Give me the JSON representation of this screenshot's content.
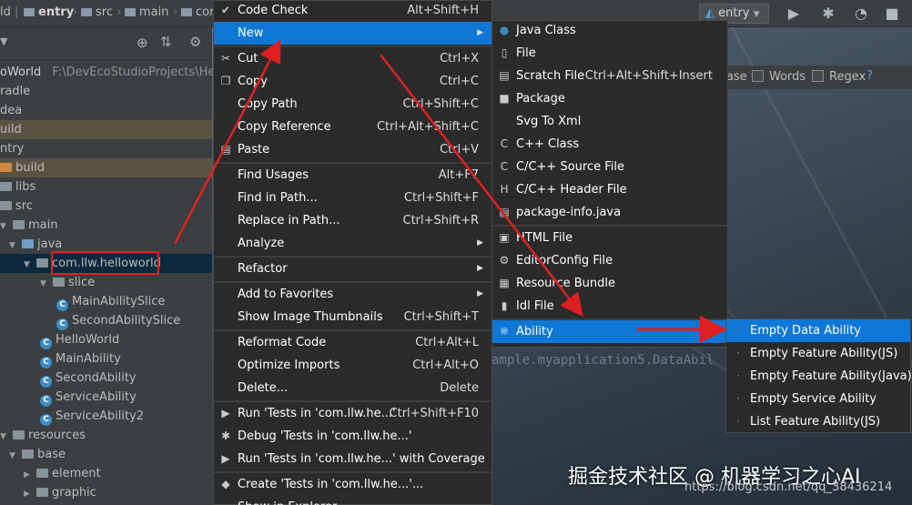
{
  "toolbar": {
    "crumbs": [
      "ld",
      "entry",
      "src",
      "main",
      "cor"
    ],
    "run_config": "entry"
  },
  "project_root": {
    "name": "oWorld",
    "path": "F:\\DevEcoStudioProjects\\HelloW"
  },
  "tree": [
    {
      "label": "radle",
      "indent": 0,
      "icon": "none",
      "style": "plain"
    },
    {
      "label": "dea",
      "indent": 0,
      "icon": "none",
      "style": "plain"
    },
    {
      "label": "uild",
      "indent": 0,
      "icon": "none",
      "style": "hl"
    },
    {
      "label": "ntry",
      "indent": 0,
      "icon": "none",
      "style": "plain"
    },
    {
      "label": "build",
      "indent": 0,
      "icon": "folder-orange",
      "style": "hl"
    },
    {
      "label": "libs",
      "indent": 0,
      "icon": "folder",
      "style": "plain"
    },
    {
      "label": "src",
      "indent": 0,
      "icon": "folder",
      "style": "plain"
    },
    {
      "label": "main",
      "indent": 1,
      "icon": "folder",
      "style": "plain"
    },
    {
      "label": "java",
      "indent": 2,
      "icon": "folder-blue",
      "style": "plain"
    },
    {
      "label": "com.llw.helloworld",
      "indent": 3,
      "icon": "folder",
      "style": "sel"
    },
    {
      "label": "slice",
      "indent": 4,
      "icon": "folder",
      "style": "plain"
    },
    {
      "label": "MainAbilitySlice",
      "indent": 5,
      "icon": "class",
      "style": "plain"
    },
    {
      "label": "SecondAbilitySlice",
      "indent": 5,
      "icon": "class",
      "style": "plain"
    },
    {
      "label": "HelloWorld",
      "indent": 4,
      "icon": "class",
      "style": "plain"
    },
    {
      "label": "MainAbility",
      "indent": 4,
      "icon": "class",
      "style": "plain"
    },
    {
      "label": "SecondAbility",
      "indent": 4,
      "icon": "class",
      "style": "plain"
    },
    {
      "label": "ServiceAbility",
      "indent": 4,
      "icon": "class",
      "style": "plain"
    },
    {
      "label": "ServiceAbility2",
      "indent": 4,
      "icon": "class",
      "style": "plain"
    },
    {
      "label": "resources",
      "indent": 1,
      "icon": "folder",
      "style": "plain"
    },
    {
      "label": "base",
      "indent": 2,
      "icon": "folder",
      "style": "plain"
    },
    {
      "label": "element",
      "indent": 3,
      "icon": "folder",
      "style": "plain"
    },
    {
      "label": "graphic",
      "indent": 3,
      "icon": "folder",
      "style": "plain"
    }
  ],
  "findbar": {
    "case_label": "ase",
    "words_label": "Words",
    "regex_label": "Regex",
    "help": "?"
  },
  "code_ghost": "ample.myapplication5.DataAbil",
  "context_menu": [
    {
      "label": "Code Check",
      "shortcut": "Alt+Shift+H",
      "icon": "check-icon"
    },
    {
      "label": "New",
      "shortcut": "",
      "submenu": true,
      "active": true
    },
    {
      "sep": true
    },
    {
      "label": "Cut",
      "shortcut": "Ctrl+X",
      "icon": "scissors-icon"
    },
    {
      "label": "Copy",
      "shortcut": "Ctrl+C",
      "icon": "copy-icon"
    },
    {
      "label": "Copy Path",
      "shortcut": "Ctrl+Shift+C"
    },
    {
      "label": "Copy Reference",
      "shortcut": "Ctrl+Alt+Shift+C"
    },
    {
      "label": "Paste",
      "shortcut": "Ctrl+V",
      "icon": "paste-icon"
    },
    {
      "sep": true
    },
    {
      "label": "Find Usages",
      "shortcut": "Alt+F7"
    },
    {
      "label": "Find in Path...",
      "shortcut": "Ctrl+Shift+F"
    },
    {
      "label": "Replace in Path...",
      "shortcut": "Ctrl+Shift+R"
    },
    {
      "label": "Analyze",
      "shortcut": "",
      "submenu": true
    },
    {
      "sep": true
    },
    {
      "label": "Refactor",
      "shortcut": "",
      "submenu": true
    },
    {
      "sep": true
    },
    {
      "label": "Add to Favorites",
      "shortcut": "",
      "submenu": true
    },
    {
      "label": "Show Image Thumbnails",
      "shortcut": "Ctrl+Shift+T"
    },
    {
      "sep": true
    },
    {
      "label": "Reformat Code",
      "shortcut": "Ctrl+Alt+L"
    },
    {
      "label": "Optimize Imports",
      "shortcut": "Ctrl+Alt+O"
    },
    {
      "label": "Delete...",
      "shortcut": "Delete"
    },
    {
      "sep": true
    },
    {
      "label": "Run 'Tests in 'com.llw.he...'",
      "shortcut": "Ctrl+Shift+F10",
      "icon": "run-icon"
    },
    {
      "label": "Debug 'Tests in 'com.llw.he...'",
      "shortcut": "",
      "icon": "debug-icon"
    },
    {
      "label": "Run 'Tests in 'com.llw.he...' with Coverage",
      "shortcut": "",
      "icon": "coverage-icon"
    },
    {
      "sep": true
    },
    {
      "label": "Create 'Tests in 'com.llw.he...'...",
      "shortcut": "",
      "icon": "create-test-icon"
    },
    {
      "label": "Show in Explorer",
      "shortcut": ""
    }
  ],
  "new_menu": [
    {
      "label": "Java Class",
      "shortcut": "",
      "icon": "java-class-icon"
    },
    {
      "label": "File",
      "shortcut": "",
      "icon": "file-icon"
    },
    {
      "label": "Scratch File",
      "shortcut": "Ctrl+Alt+Shift+Insert",
      "icon": "scratch-file-icon"
    },
    {
      "label": "Package",
      "shortcut": "",
      "icon": "package-icon"
    },
    {
      "label": "Svg To Xml",
      "shortcut": "",
      "icon": ""
    },
    {
      "label": "C++ Class",
      "shortcut": "",
      "icon": "cpp-class-icon"
    },
    {
      "label": "C/C++ Source File",
      "shortcut": "",
      "icon": "c-source-icon"
    },
    {
      "label": "C/C++ Header File",
      "shortcut": "",
      "icon": "c-header-icon"
    },
    {
      "label": "package-info.java",
      "shortcut": "",
      "icon": "package-info-icon"
    },
    {
      "sep": true
    },
    {
      "label": "HTML File",
      "shortcut": "",
      "icon": "html-icon"
    },
    {
      "label": "EditorConfig File",
      "shortcut": "",
      "icon": "gear-icon"
    },
    {
      "label": "Resource Bundle",
      "shortcut": "",
      "icon": "resource-bundle-icon"
    },
    {
      "label": "Idl File",
      "shortcut": "",
      "icon": "idl-file-icon"
    },
    {
      "sep": true
    },
    {
      "label": "Ability",
      "shortcut": "",
      "icon": "ability-icon",
      "submenu": true,
      "active": true
    }
  ],
  "ability_menu": [
    {
      "label": "Empty Data Ability",
      "active": true
    },
    {
      "label": "Empty Feature Ability(JS)"
    },
    {
      "label": "Empty Feature Ability(Java)"
    },
    {
      "label": "Empty Service Ability"
    },
    {
      "label": "List Feature Ability(JS)"
    }
  ],
  "watermark": "掘金技术社区 @ 机器学习之心AI",
  "url": "https://blog.csdn.net/qq_38436214",
  "colors": {
    "menu_bg": "#2b2b2b",
    "active": "#0f77d6",
    "annotation_red": "#e02020"
  }
}
